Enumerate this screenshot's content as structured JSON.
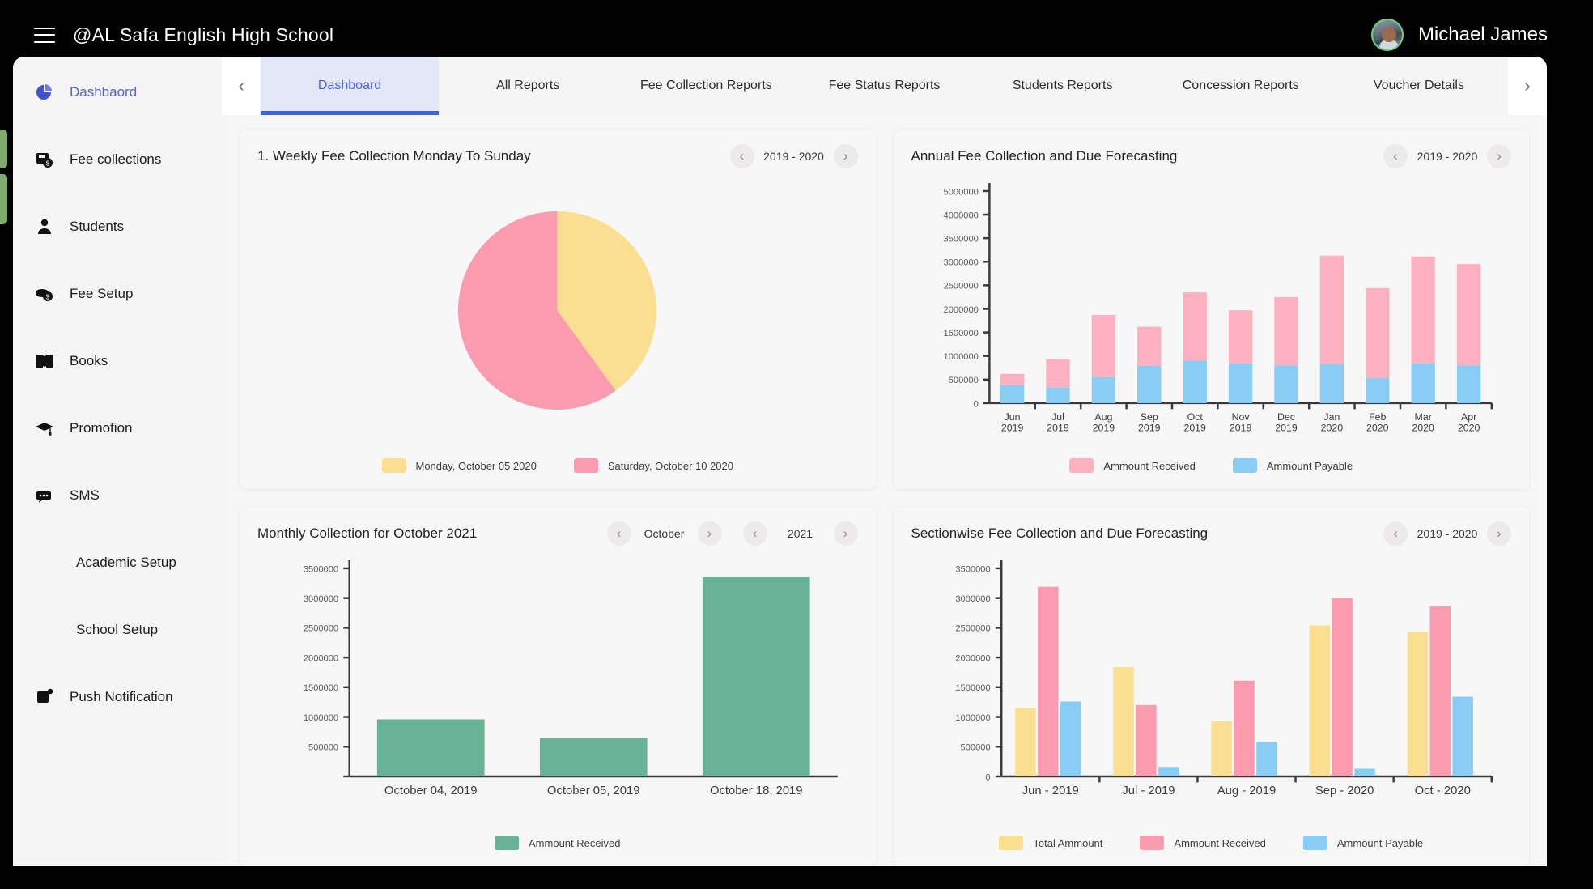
{
  "header": {
    "menu_icon": "hamburger-icon",
    "title": "@AL Safa English High School",
    "user_name": "Michael James",
    "avatar_icon": "user-avatar"
  },
  "sidebar": {
    "items": [
      {
        "label": "Dashbaord",
        "icon": "pie-chart-icon",
        "active": true
      },
      {
        "label": "Fee collections",
        "icon": "money-save-icon",
        "active": false
      },
      {
        "label": "Students",
        "icon": "person-icon",
        "active": false
      },
      {
        "label": "Fee Setup",
        "icon": "coins-icon",
        "active": false
      },
      {
        "label": "Books",
        "icon": "book-icon",
        "active": false
      },
      {
        "label": "Promotion",
        "icon": "graduation-cap-icon",
        "active": false
      },
      {
        "label": "SMS",
        "icon": "chat-icon",
        "active": false
      },
      {
        "label": "Academic Setup",
        "icon": "",
        "active": false
      },
      {
        "label": "School Setup",
        "icon": "",
        "active": false
      },
      {
        "label": "Push Notification",
        "icon": "notification-icon",
        "active": false
      }
    ]
  },
  "tabs": {
    "prev_label": "‹",
    "next_label": "›",
    "items": [
      {
        "label": "Dashboard",
        "active": true
      },
      {
        "label": "All Reports",
        "active": false
      },
      {
        "label": "Fee Collection Reports",
        "active": false
      },
      {
        "label": "Fee Status Reports",
        "active": false
      },
      {
        "label": "Students Reports",
        "active": false
      },
      {
        "label": "Concession Reports",
        "active": false
      },
      {
        "label": "Voucher Details",
        "active": false
      }
    ]
  },
  "colors": {
    "yellow": "#fbdf91",
    "pink": "#fb9bb0",
    "pink_light": "#fcb0c0",
    "blue": "#89cdf4",
    "green": "#68b396",
    "accent": "#3b62e0"
  },
  "cards": {
    "weekly": {
      "title": "1. Weekly Fee Collection Monday To Sunday",
      "year_value": "2019 - 2020",
      "prev_label": "‹",
      "next_label": "›"
    },
    "annual": {
      "title": "Annual Fee Collection and Due Forecasting",
      "year_value": "2019 - 2020",
      "prev_label": "‹",
      "next_label": "›"
    },
    "monthly": {
      "title": "Monthly Collection for October 2021",
      "month_value": "October",
      "year_value": "2021",
      "prev_label": "‹",
      "next_label": "›"
    },
    "sectionwise": {
      "title": "Sectionwise Fee Collection and Due Forecasting",
      "year_value": "2019 - 2020",
      "prev_label": "‹",
      "next_label": "›"
    }
  },
  "chart_data": [
    {
      "id": "weekly_pie",
      "type": "pie",
      "title": "1. Weekly Fee Collection Monday To Sunday",
      "legend_position": "bottom",
      "slices": [
        {
          "label": "Monday, October 05 2020",
          "value": 40,
          "color": "#fbdf91"
        },
        {
          "label": "Saturday, October 10 2020",
          "value": 60,
          "color": "#fb9bb0"
        }
      ]
    },
    {
      "id": "annual_stacked",
      "type": "bar",
      "stacked": true,
      "title": "Annual Fee Collection and Due Forecasting",
      "xlabel": "",
      "ylabel": "",
      "grid": false,
      "legend_position": "bottom",
      "ylim": [
        0,
        5000000
      ],
      "yticks": [
        0,
        500000,
        1000000,
        1500000,
        2000000,
        2500000,
        3000000,
        3500000,
        4000000,
        5000000
      ],
      "ytick_labels": [
        "0",
        "500000",
        "1000000",
        "1500000",
        "2000000",
        "2500000",
        "3000000",
        "3500000",
        "4000000",
        "5000000"
      ],
      "categories": [
        "Jun\n2019",
        "Jul\n2019",
        "Aug\n2019",
        "Sep\n2019",
        "Oct\n2019",
        "Nov\n2019",
        "Dec\n2019",
        "Jan\n2020",
        "Feb\n2020",
        "Mar\n2020",
        "Apr\n2020"
      ],
      "series": [
        {
          "name": "Ammount Payable",
          "color": "#89cdf4",
          "values": [
            380000,
            330000,
            550000,
            790000,
            900000,
            840000,
            800000,
            830000,
            530000,
            840000,
            800000
          ]
        },
        {
          "name": "Ammount Received",
          "color": "#fcb0c0",
          "values": [
            240000,
            600000,
            1320000,
            830000,
            1450000,
            1130000,
            1450000,
            2300000,
            1910000,
            2270000,
            2150000
          ]
        }
      ],
      "totals": [
        620000,
        930000,
        1870000,
        1620000,
        2350000,
        1970000,
        2250000,
        3130000,
        2440000,
        3110000,
        2950000
      ]
    },
    {
      "id": "monthly_bar",
      "type": "bar",
      "stacked": false,
      "title": "Monthly Collection for October 2021",
      "xlabel": "",
      "ylabel": "",
      "grid": false,
      "legend_position": "bottom",
      "ylim": [
        0,
        3500000
      ],
      "yticks": [
        0,
        500000,
        1000000,
        1500000,
        2000000,
        2500000,
        3000000,
        3500000
      ],
      "ytick_labels": [
        "",
        "500000",
        "1000000",
        "1500000",
        "2000000",
        "2500000",
        "3000000",
        "3500000"
      ],
      "categories": [
        "October 04, 2019",
        "October 05, 2019",
        "October 18, 2019"
      ],
      "series": [
        {
          "name": "Ammount Received",
          "color": "#68b396",
          "values": [
            960000,
            640000,
            3350000
          ]
        }
      ]
    },
    {
      "id": "sectionwise_grouped",
      "type": "bar",
      "stacked": false,
      "title": "Sectionwise Fee Collection and Due Forecasting",
      "xlabel": "",
      "ylabel": "",
      "grid": false,
      "legend_position": "bottom",
      "ylim": [
        0,
        3500000
      ],
      "yticks": [
        0,
        500000,
        1000000,
        1500000,
        2000000,
        2500000,
        3000000,
        3500000
      ],
      "ytick_labels": [
        "0",
        "500000",
        "1000000",
        "1500000",
        "2000000",
        "2500000",
        "3000000",
        "3500000"
      ],
      "categories": [
        "Jun - 2019",
        "Jul - 2019",
        "Aug - 2019",
        "Sep - 2020",
        "Oct - 2020"
      ],
      "series": [
        {
          "name": "Total Ammount",
          "color": "#fbdf91",
          "values": [
            1150000,
            1840000,
            930000,
            2540000,
            2430000
          ]
        },
        {
          "name": "Ammount Received",
          "color": "#fb9bb0",
          "values": [
            3190000,
            1200000,
            1610000,
            3000000,
            2860000
          ]
        },
        {
          "name": "Ammount Payable",
          "color": "#89cdf4",
          "values": [
            1260000,
            160000,
            580000,
            130000,
            1340000
          ]
        }
      ]
    }
  ]
}
